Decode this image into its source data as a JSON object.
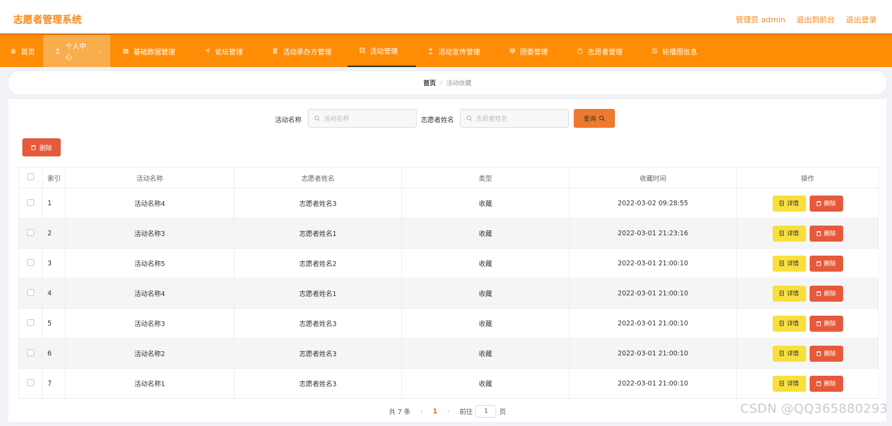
{
  "header": {
    "title": "志愿者管理系统",
    "admin_label": "管理员 admin",
    "to_front": "退出到前台",
    "logout": "退出登录"
  },
  "nav": [
    {
      "label": "首页",
      "icon": "home-icon"
    },
    {
      "label": "个人中心",
      "icon": "user-icon"
    },
    {
      "label": "基础数据管理",
      "icon": "database-icon"
    },
    {
      "label": "论坛管理",
      "icon": "send-icon"
    },
    {
      "label": "活动承办方管理",
      "icon": "document-icon"
    },
    {
      "label": "活动管理",
      "icon": "grid-icon"
    },
    {
      "label": "活动宣传管理",
      "icon": "user-icon"
    },
    {
      "label": "团委管理",
      "icon": "monitor-icon"
    },
    {
      "label": "志愿者管理",
      "icon": "power-icon"
    },
    {
      "label": "轮播图信息",
      "icon": "list-icon"
    }
  ],
  "breadcrumb": {
    "home": "首页",
    "separator": "/",
    "current": "活动收藏"
  },
  "search": {
    "activity_label": "活动名称",
    "activity_placeholder": "活动名称",
    "volunteer_label": "志愿者姓名",
    "volunteer_placeholder": "志愿者姓名",
    "query_label": "查询"
  },
  "toolbar": {
    "delete_label": "删除"
  },
  "table": {
    "columns": [
      "索引",
      "活动名称",
      "志愿者姓名",
      "类型",
      "收藏时间",
      "操作"
    ],
    "rows": [
      {
        "index": "1",
        "activity": "活动名称4",
        "volunteer": "志愿者姓名3",
        "type": "收藏",
        "time": "2022-03-02 09:28:55"
      },
      {
        "index": "2",
        "activity": "活动名称3",
        "volunteer": "志愿者姓名1",
        "type": "收藏",
        "time": "2022-03-01 21:23:16"
      },
      {
        "index": "3",
        "activity": "活动名称5",
        "volunteer": "志愿者姓名2",
        "type": "收藏",
        "time": "2022-03-01 21:00:10"
      },
      {
        "index": "4",
        "activity": "活动名称4",
        "volunteer": "志愿者姓名1",
        "type": "收藏",
        "time": "2022-03-01 21:00:10"
      },
      {
        "index": "5",
        "activity": "活动名称3",
        "volunteer": "志愿者姓名3",
        "type": "收藏",
        "time": "2022-03-01 21:00:10"
      },
      {
        "index": "6",
        "activity": "活动名称2",
        "volunteer": "志愿者姓名3",
        "type": "收藏",
        "time": "2022-03-01 21:00:10"
      },
      {
        "index": "7",
        "activity": "活动名称1",
        "volunteer": "志愿者姓名3",
        "type": "收藏",
        "time": "2022-03-01 21:00:10"
      }
    ],
    "detail_label": "详情",
    "delete_label": "删除"
  },
  "pagination": {
    "total": "共 7 条",
    "current_page": "1",
    "goto_prefix": "前往",
    "goto_value": "1",
    "goto_suffix": "页"
  },
  "watermark": "CSDN @QQ365880293",
  "colors": {
    "brand": "#f28a1e",
    "nav_bg": "#fe8c05",
    "danger": "#e55a3c",
    "detail": "#f9df3d"
  }
}
